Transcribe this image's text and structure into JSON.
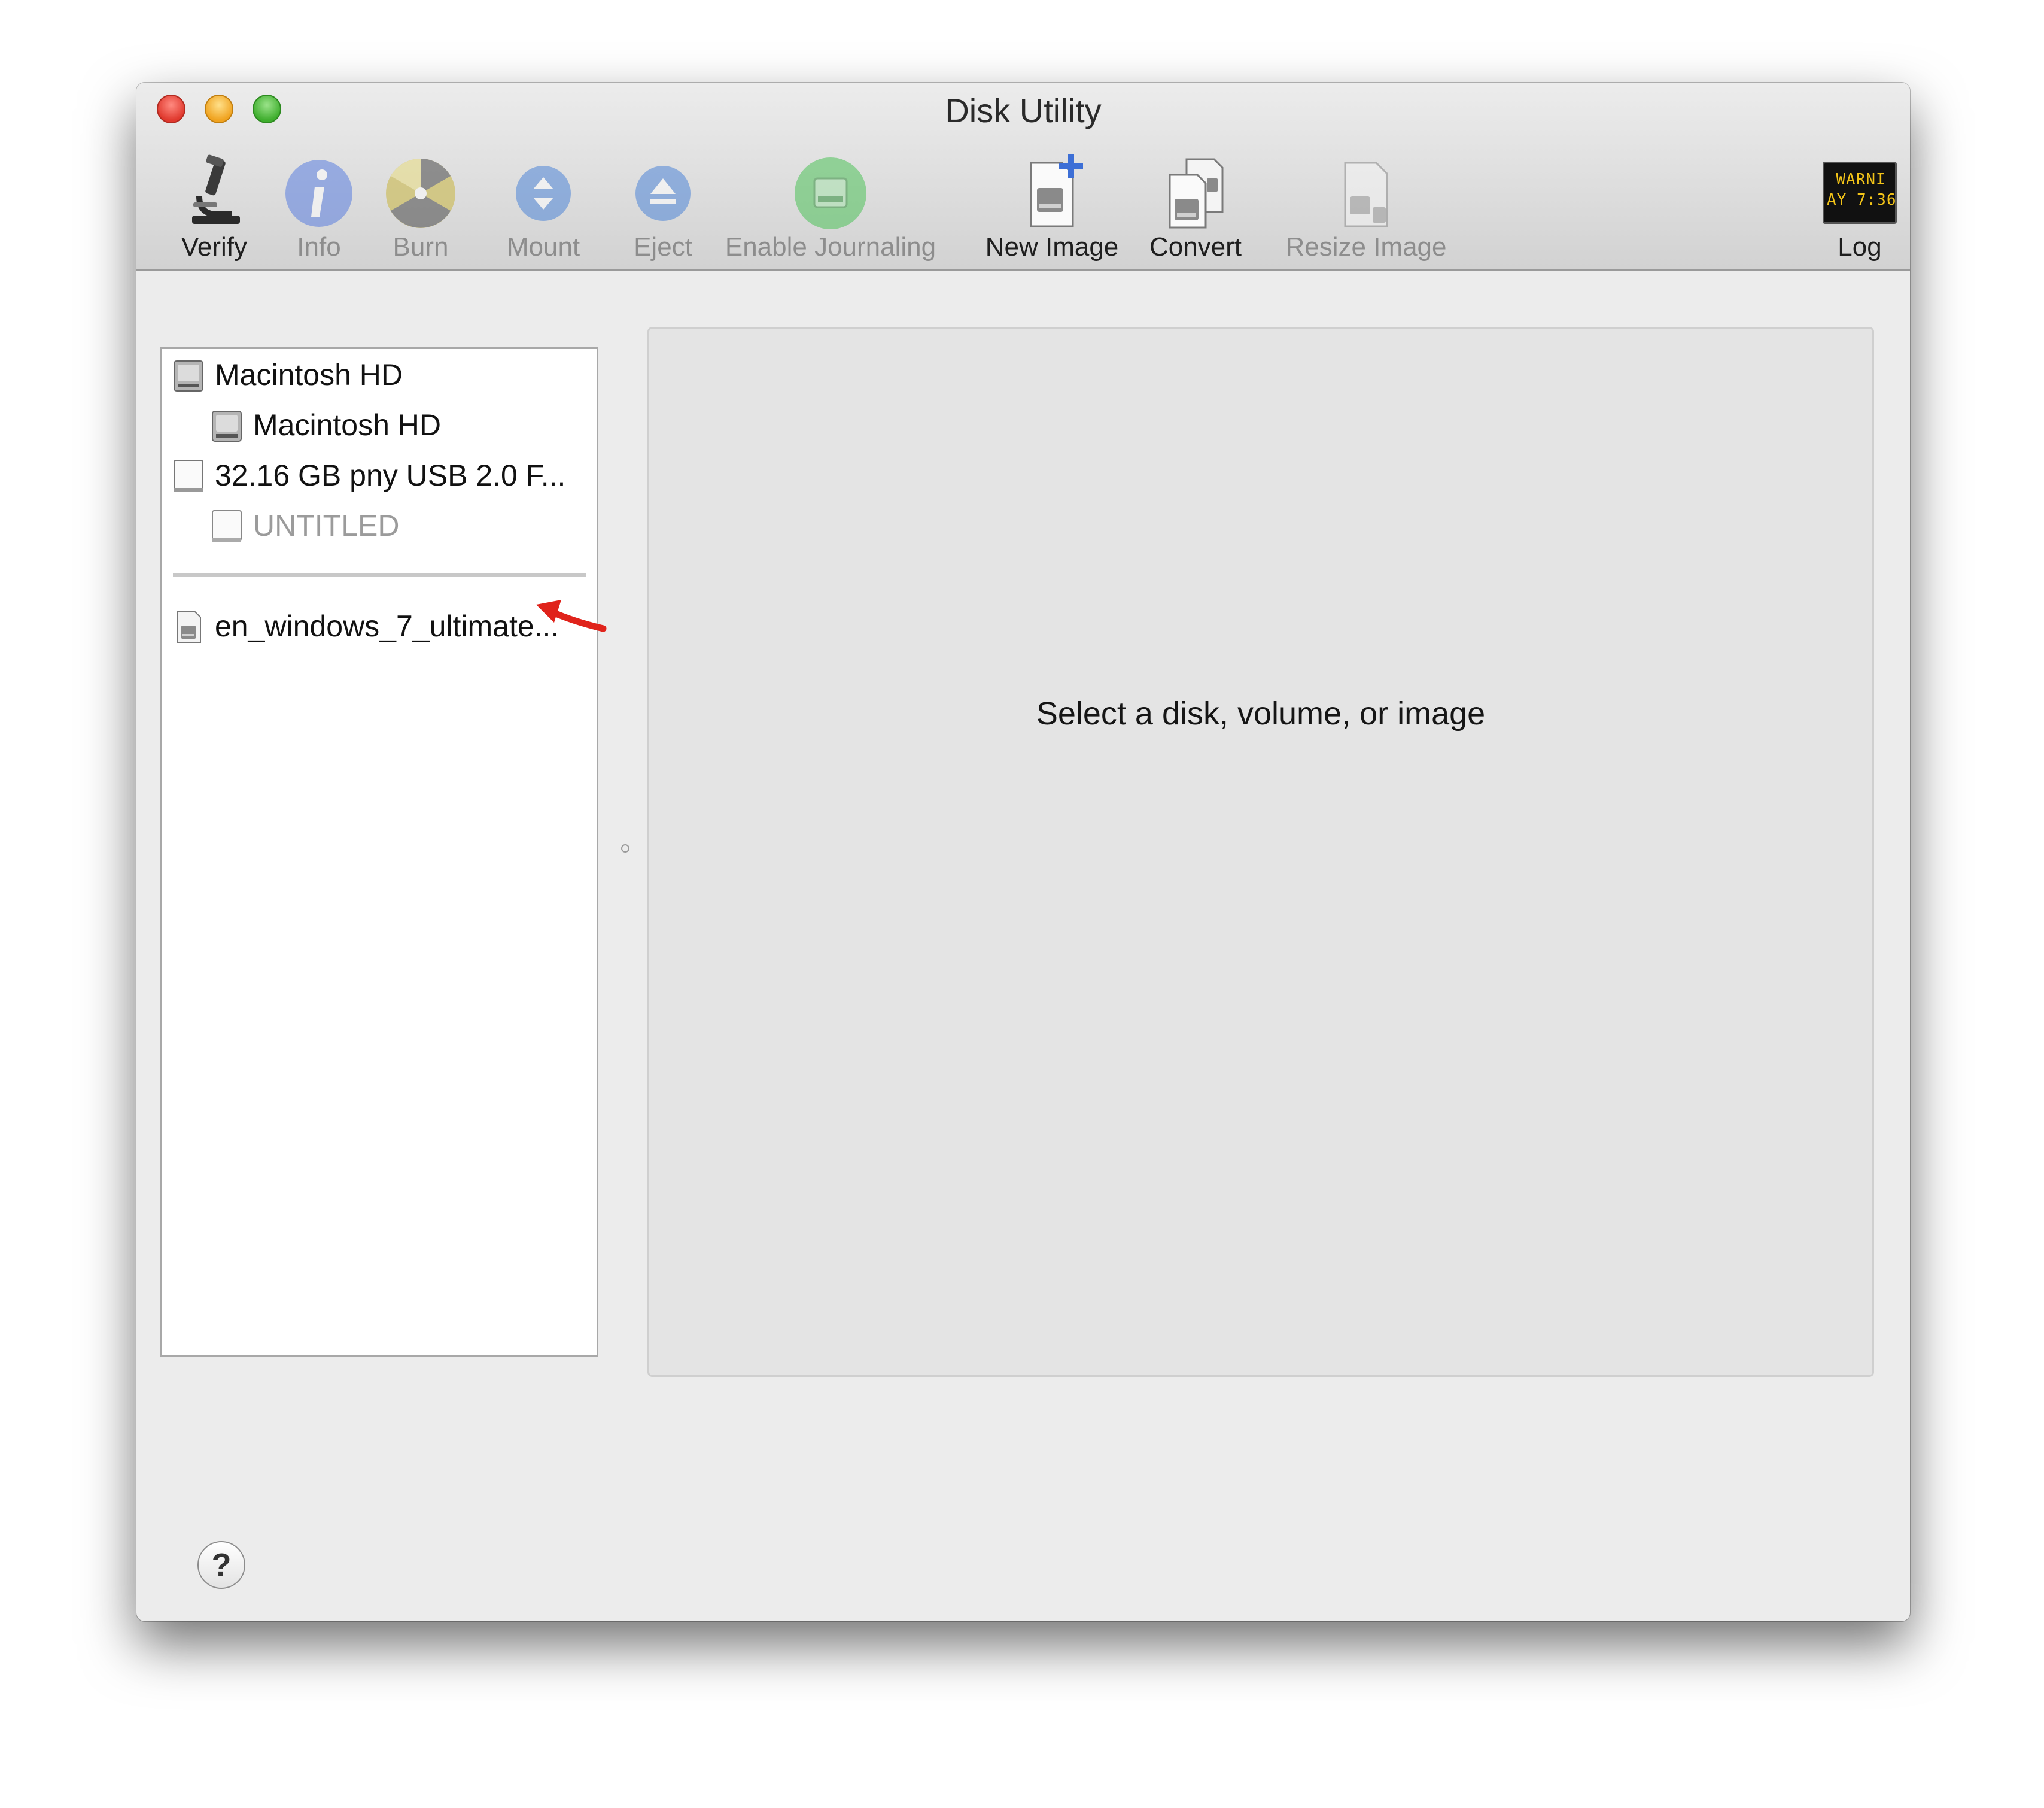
{
  "window": {
    "title": "Disk Utility"
  },
  "toolbar": {
    "items": [
      {
        "label": "Verify",
        "icon": "microscope-icon",
        "enabled": true
      },
      {
        "label": "Info",
        "icon": "info-icon",
        "enabled": false
      },
      {
        "label": "Burn",
        "icon": "burn-icon",
        "enabled": false
      },
      {
        "label": "Mount",
        "icon": "mount-icon",
        "enabled": false
      },
      {
        "label": "Eject",
        "icon": "eject-icon",
        "enabled": false
      },
      {
        "label": "Enable Journaling",
        "icon": "journaling-icon",
        "enabled": false
      },
      {
        "label": "New Image",
        "icon": "new-image-icon",
        "enabled": true
      },
      {
        "label": "Convert",
        "icon": "convert-icon",
        "enabled": true
      },
      {
        "label": "Resize Image",
        "icon": "resize-image-icon",
        "enabled": false
      },
      {
        "label": "Log",
        "icon": "log-icon",
        "enabled": true
      }
    ],
    "log_badge_text": "WARNI\nAY 7:36"
  },
  "sidebar": {
    "items": [
      {
        "label": "Macintosh HD",
        "icon": "hard-disk-icon"
      },
      {
        "label": "Macintosh HD",
        "icon": "hard-disk-icon"
      },
      {
        "label": "32.16 GB pny USB 2.0 F...",
        "icon": "usb-drive-icon"
      },
      {
        "label": "UNTITLED",
        "icon": "usb-volume-icon"
      }
    ],
    "images": [
      {
        "label": "en_windows_7_ultimate...",
        "icon": "disk-image-icon"
      }
    ]
  },
  "detail": {
    "message": "Select a disk, volume, or image"
  },
  "help": {
    "label": "?"
  },
  "colors": {
    "annotation_arrow": "#e0231b",
    "window_bg": "#ececec",
    "detail_bg": "#e4e4e4"
  }
}
